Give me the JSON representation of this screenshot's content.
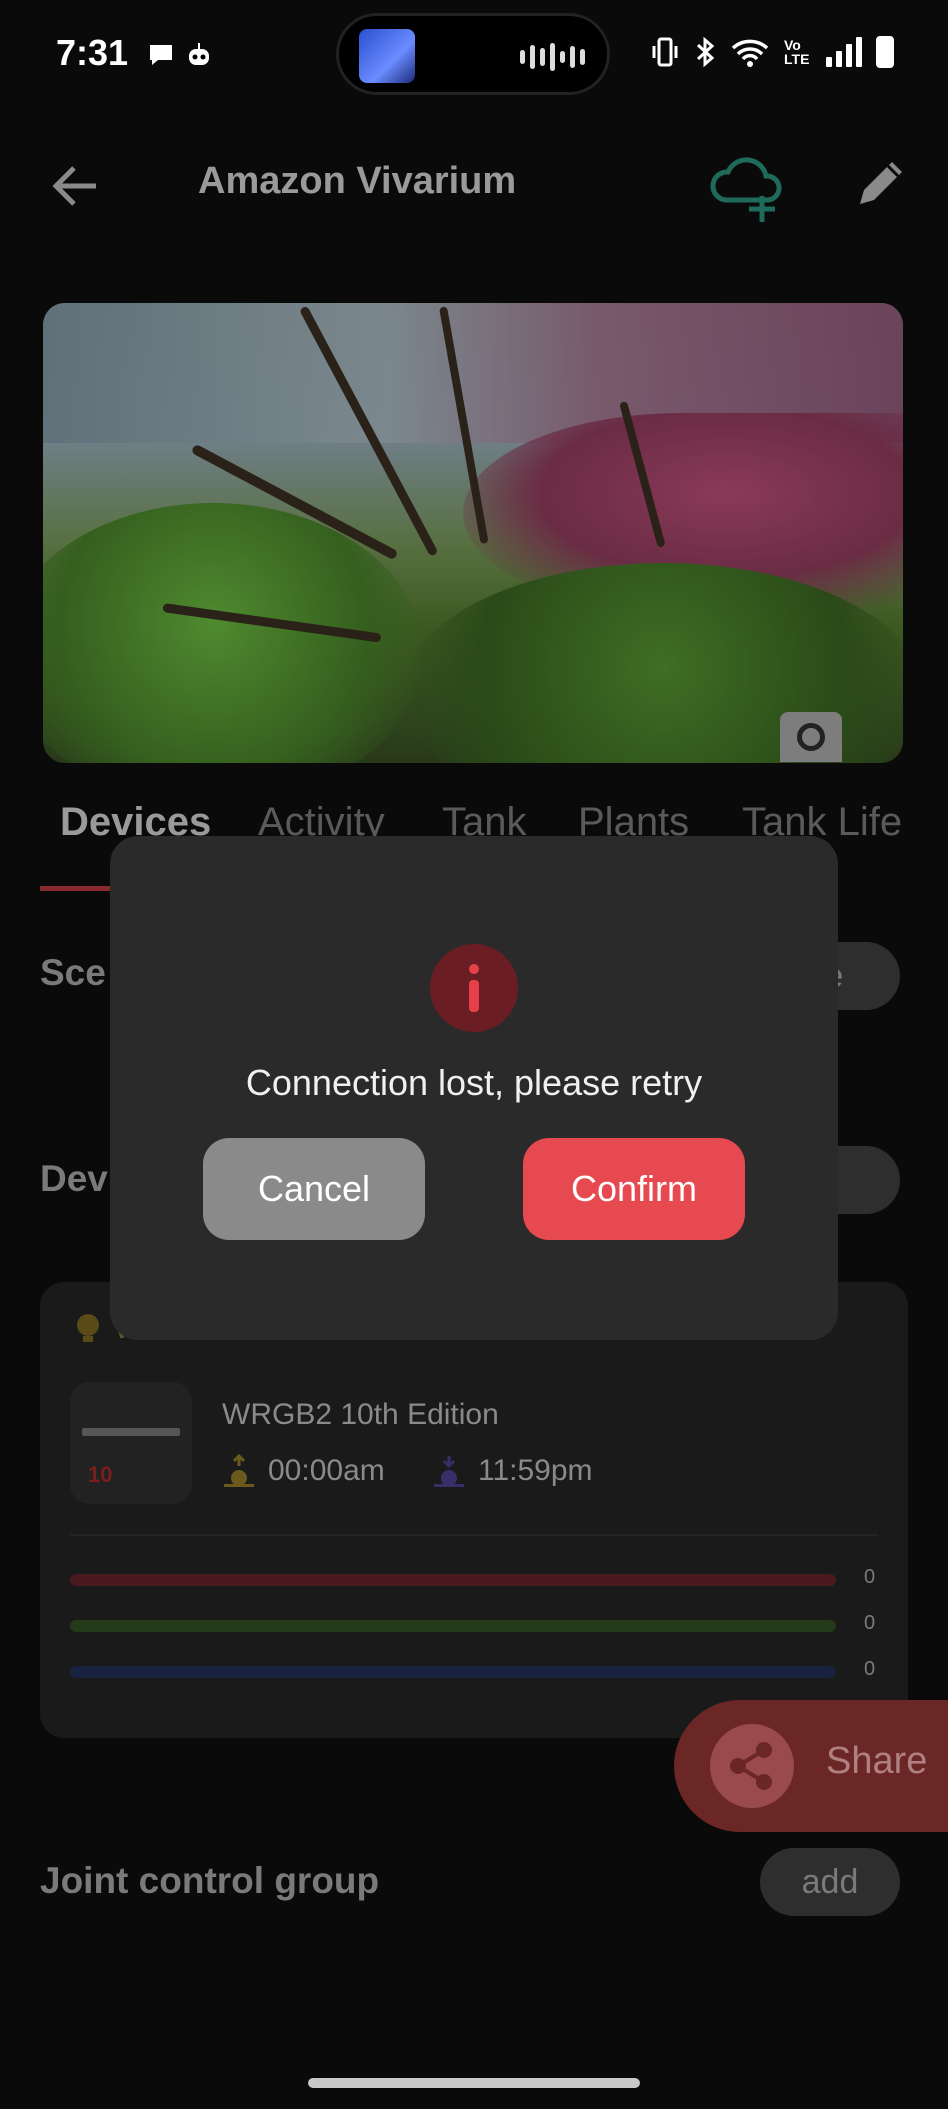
{
  "status_bar": {
    "time": "7:31",
    "volte": "Vo LTE"
  },
  "header": {
    "title": "Amazon Vivarium"
  },
  "tabs": [
    "Devices",
    "Activity",
    "Tank",
    "Plants",
    "Tank Life"
  ],
  "scenes": {
    "title_partial": "Sce",
    "button_partial": "le"
  },
  "devices": {
    "title_partial": "Dev",
    "button_partial": "d"
  },
  "device_card": {
    "header_label": "WRGB2 10th Edition",
    "thumb_label": "10",
    "name": "WRGB2 10th Edition",
    "sunrise": "00:00am",
    "sunset": "11:59pm",
    "channels": [
      {
        "color": "#6a1e24",
        "value": "0"
      },
      {
        "color": "#2c4a1e",
        "value": "0"
      },
      {
        "color": "#1e2e5a",
        "value": "0"
      }
    ]
  },
  "joint_control": {
    "title": "Joint control group",
    "button": "add"
  },
  "share": {
    "label": "Share"
  },
  "dialog": {
    "message": "Connection lost, please retry",
    "cancel": "Cancel",
    "confirm": "Confirm"
  },
  "colors": {
    "accent": "#e64950",
    "card": "#1a1a1a",
    "modal": "#2a2a2a"
  }
}
